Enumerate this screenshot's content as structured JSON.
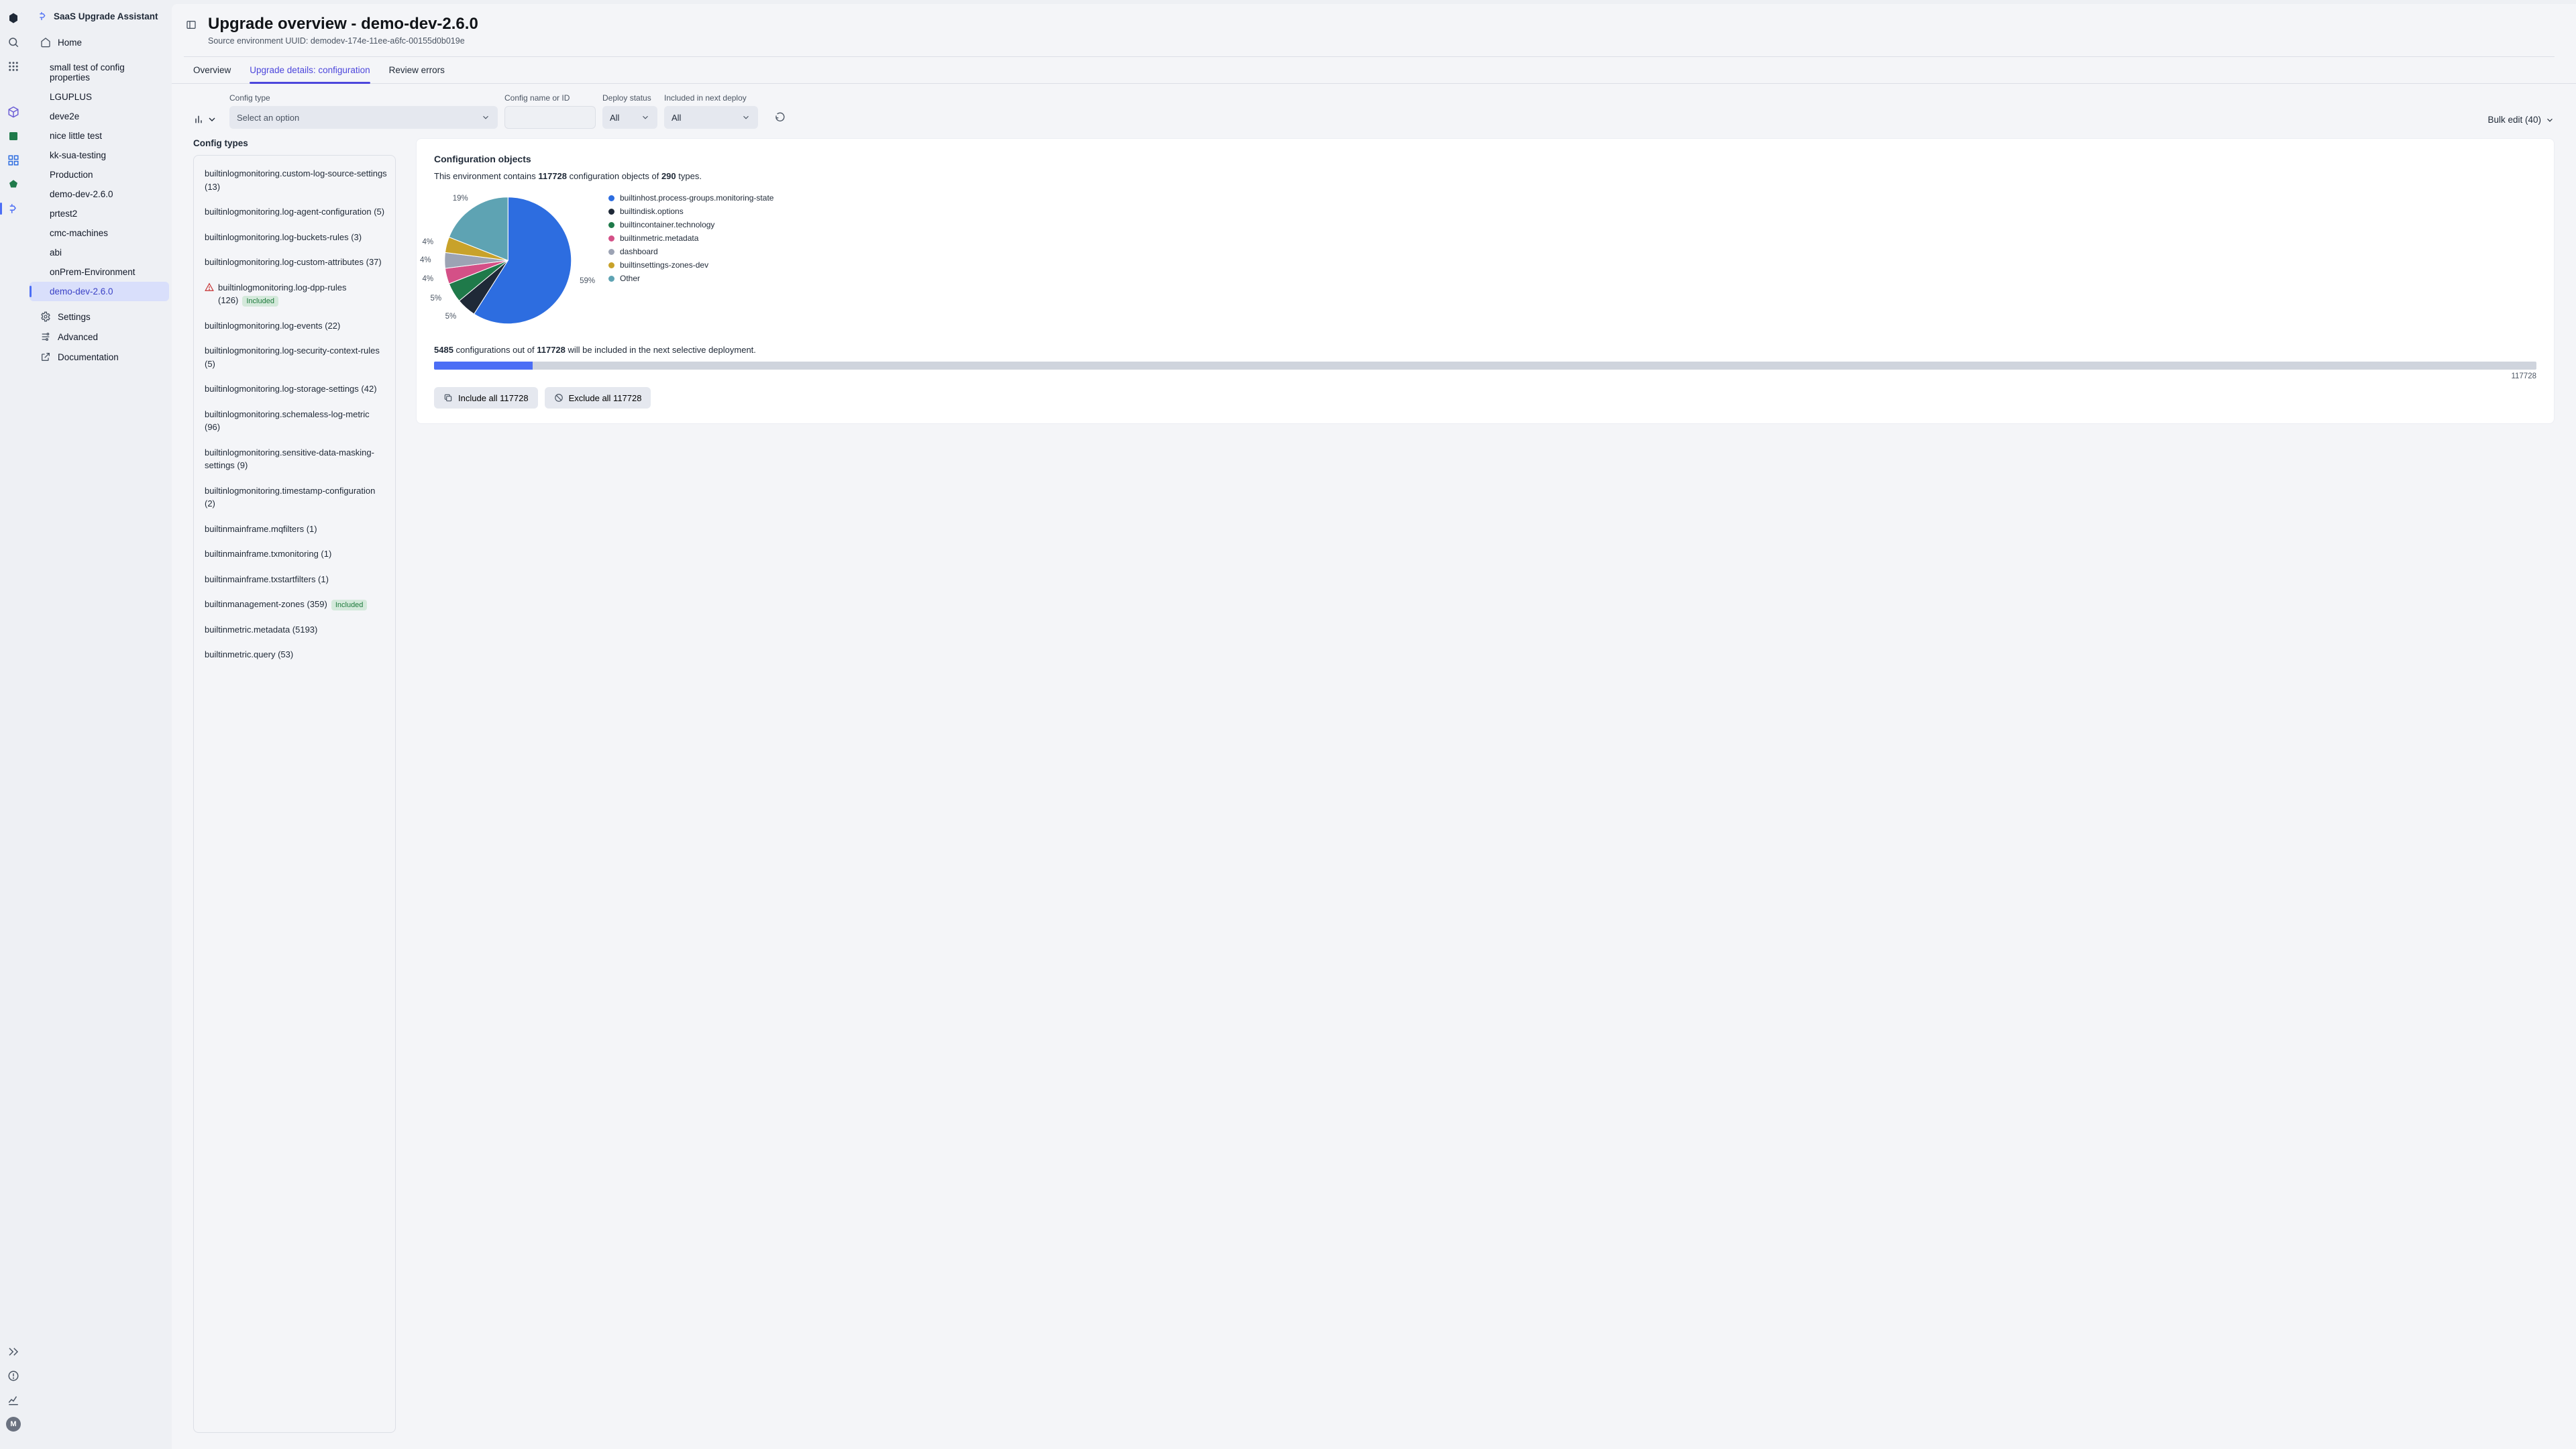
{
  "app": {
    "title": "SaaS Upgrade Assistant"
  },
  "sidebar": {
    "home": "Home",
    "items": [
      "small test of config properties",
      "LGUPLUS",
      "deve2e",
      "nice little test",
      "kk-sua-testing",
      "Production",
      "demo-dev-2.6.0",
      "prtest2",
      "cmc-machines",
      "abi",
      "onPrem-Environment",
      "demo-dev-2.6.0"
    ],
    "active_index": 11,
    "settings": "Settings",
    "advanced": "Advanced",
    "documentation": "Documentation"
  },
  "page": {
    "title": "Upgrade overview - demo-dev-2.6.0",
    "subtitle": "Source environment UUID: demodev-174e-11ee-a6fc-00155d0b019e"
  },
  "tabs": {
    "items": [
      "Overview",
      "Upgrade details: configuration",
      "Review errors"
    ],
    "active": 1
  },
  "filters": {
    "config_type": {
      "label": "Config type",
      "placeholder": "Select an option"
    },
    "config_name": {
      "label": "Config name or ID",
      "value": ""
    },
    "deploy_status": {
      "label": "Deploy status",
      "value": "All"
    },
    "included": {
      "label": "Included in next deploy",
      "value": "All"
    },
    "bulk_edit_label": "Bulk edit (40)"
  },
  "config_types": {
    "title": "Config types",
    "items": [
      {
        "name": "builtinlogmonitoring.custom-log-source-settings",
        "count": 13
      },
      {
        "name": "builtinlogmonitoring.log-agent-configuration",
        "count": 5
      },
      {
        "name": "builtinlogmonitoring.log-buckets-rules",
        "count": 3
      },
      {
        "name": "builtinlogmonitoring.log-custom-attributes",
        "count": 37
      },
      {
        "name": "builtinlogmonitoring.log-dpp-rules",
        "count": 126,
        "warn": true,
        "included": true
      },
      {
        "name": "builtinlogmonitoring.log-events",
        "count": 22
      },
      {
        "name": "builtinlogmonitoring.log-security-context-rules",
        "count": 5
      },
      {
        "name": "builtinlogmonitoring.log-storage-settings",
        "count": 42
      },
      {
        "name": "builtinlogmonitoring.schemaless-log-metric",
        "count": 96
      },
      {
        "name": "builtinlogmonitoring.sensitive-data-masking-settings",
        "count": 9
      },
      {
        "name": "builtinlogmonitoring.timestamp-configuration",
        "count": 2
      },
      {
        "name": "builtinmainframe.mqfilters",
        "count": 1
      },
      {
        "name": "builtinmainframe.txmonitoring",
        "count": 1
      },
      {
        "name": "builtinmainframe.txstartfilters",
        "count": 1
      },
      {
        "name": "builtinmanagement-zones",
        "count": 359,
        "included": true
      },
      {
        "name": "builtinmetric.metadata",
        "count": 5193
      },
      {
        "name": "builtinmetric.query",
        "count": 53
      }
    ],
    "included_badge": "Included"
  },
  "overview_card": {
    "title": "Configuration objects",
    "intro_prefix": "This environment contains ",
    "total_objects": "117728",
    "intro_mid": " configuration objects of ",
    "total_types": "290",
    "intro_suffix": " types.",
    "legend": [
      {
        "label": "builtinhost.process-groups.monitoring-state",
        "color": "#2d6de0"
      },
      {
        "label": "builtindisk.options",
        "color": "#1f2937"
      },
      {
        "label": "builtincontainer.technology",
        "color": "#1f7a4a"
      },
      {
        "label": "builtinmetric.metadata",
        "color": "#d45087"
      },
      {
        "label": "dashboard",
        "color": "#9ca3b4"
      },
      {
        "label": "builtinsettings-zones-dev",
        "color": "#c8a22a"
      },
      {
        "label": "Other",
        "color": "#5ea3b3"
      }
    ],
    "deploy": {
      "included": "5485",
      "mid": " configurations out of ",
      "total": "117728",
      "suffix": " will be included in the next selective deployment.",
      "progress_pct": 4.7,
      "total_label": "117728"
    },
    "buttons": {
      "include_all": "Include all 117728",
      "exclude_all": "Exclude all 117728"
    }
  },
  "chart_data": {
    "type": "pie",
    "title": "Configuration objects",
    "series": [
      {
        "name": "builtinhost.process-groups.monitoring-state",
        "pct": 59,
        "color": "#2d6de0"
      },
      {
        "name": "builtindisk.options",
        "pct": 5,
        "color": "#1f2937"
      },
      {
        "name": "builtincontainer.technology",
        "pct": 5,
        "color": "#1f7a4a"
      },
      {
        "name": "builtinmetric.metadata",
        "pct": 4,
        "color": "#d45087"
      },
      {
        "name": "dashboard",
        "pct": 4,
        "color": "#9ca3b4"
      },
      {
        "name": "builtinsettings-zones-dev",
        "pct": 4,
        "color": "#c8a22a"
      },
      {
        "name": "Other",
        "pct": 19,
        "color": "#5ea3b3"
      }
    ]
  },
  "rail_avatar": "M"
}
